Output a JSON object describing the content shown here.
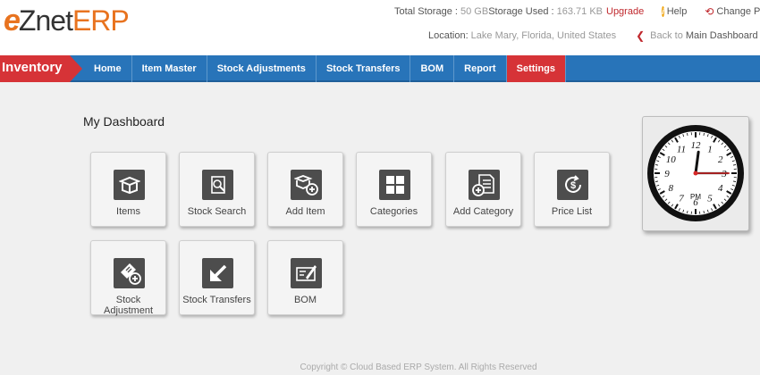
{
  "header": {
    "logo": {
      "e": "e",
      "znet": "Znet",
      "erp": "ERP"
    },
    "storage": {
      "total_label": "Total Storage :",
      "total_value": "50 GB",
      "used_label": "Storage Used :",
      "used_value": "163.71 KB",
      "upgrade": "Upgrade"
    },
    "help": "Help",
    "change_password": "Change Passw",
    "location_label": "Location:",
    "location_value": "Lake Mary, Florida, United States",
    "back_prefix": "Back to",
    "back_target": "Main Dashboard"
  },
  "nav": {
    "module": "Inventory",
    "items": [
      {
        "label": "Home"
      },
      {
        "label": "Item Master"
      },
      {
        "label": "Stock Adjustments"
      },
      {
        "label": "Stock Transfers"
      },
      {
        "label": "BOM"
      },
      {
        "label": "Report"
      },
      {
        "label": "Settings"
      }
    ],
    "active": "Settings"
  },
  "dashboard": {
    "title": "My Dashboard",
    "tiles": [
      {
        "label": "Items",
        "icon": "items-box-icon"
      },
      {
        "label": "Stock Search",
        "icon": "stock-search-icon"
      },
      {
        "label": "Add Item",
        "icon": "add-item-icon"
      },
      {
        "label": "Categories",
        "icon": "categories-grid-icon"
      },
      {
        "label": "Add Category",
        "icon": "add-category-icon"
      },
      {
        "label": "Price List",
        "icon": "price-list-icon"
      },
      {
        "label": "Stock Adjustment",
        "icon": "stock-adjustment-icon"
      },
      {
        "label": "Stock Transfers",
        "icon": "stock-transfers-icon"
      },
      {
        "label": "BOM",
        "icon": "bom-icon"
      }
    ]
  },
  "clock": {
    "period": "PM",
    "time": "12:15",
    "numbers": [
      "12",
      "1",
      "2",
      "3",
      "4",
      "5",
      "6",
      "7",
      "8",
      "9",
      "10",
      "11"
    ]
  },
  "footer": {
    "copyright": "Copyright © Cloud Based ERP System. All Rights Reserved"
  },
  "colors": {
    "nav_blue": "#2874b9",
    "accent_red": "#d63337",
    "logo_orange": "#e8731f",
    "icon_gray": "#4d4d4d"
  }
}
